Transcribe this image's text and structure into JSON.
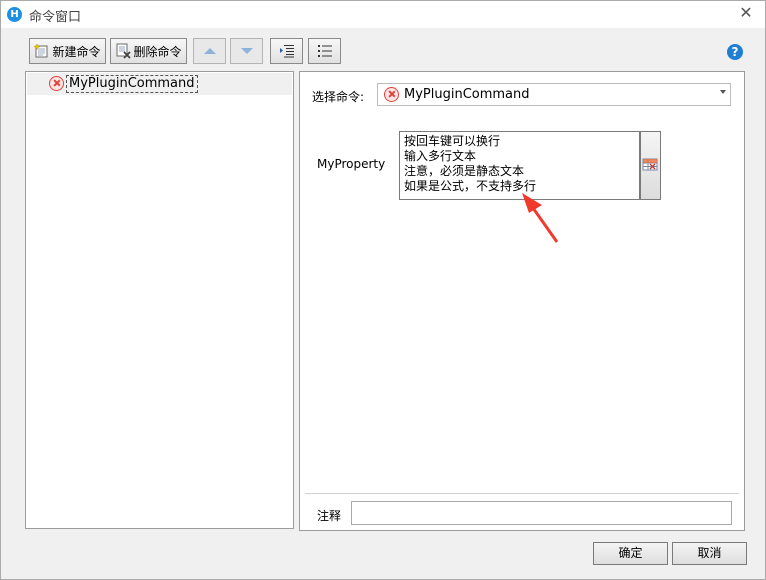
{
  "window": {
    "title": "命令窗口",
    "app_icon_letter": "H"
  },
  "toolbar": {
    "new_label": "新建命令",
    "delete_label": "删除命令"
  },
  "tree": {
    "items": [
      {
        "label": "MyPluginCommand",
        "status": "error"
      }
    ]
  },
  "command": {
    "select_label": "选择命令:",
    "selected": "MyPluginCommand"
  },
  "property": {
    "name": "MyProperty",
    "lines": [
      "按回车键可以换行",
      "输入多行文本",
      "注意，必须是静态文本",
      "如果是公式，不支持多行"
    ]
  },
  "note": {
    "label": "注释",
    "value": ""
  },
  "buttons": {
    "ok": "确定",
    "cancel": "取消"
  },
  "colors": {
    "accent_blue": "#1e7fd4",
    "error_red": "#e0403a",
    "annotation_arrow": "#f03a2e"
  }
}
